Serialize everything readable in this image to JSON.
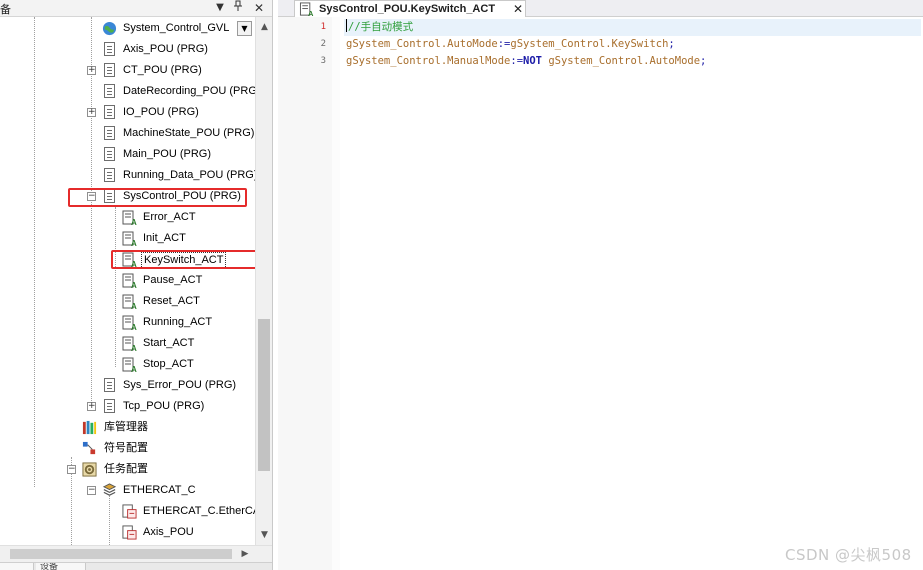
{
  "left_panel": {
    "title": "备",
    "header_buttons": {
      "dropdown": "▼",
      "pin": "ᵖ",
      "close": "✕"
    },
    "tree": {
      "global_var_list": "System_Control_GVL",
      "items": [
        {
          "label": "Axis_POU (PRG)",
          "expander": ""
        },
        {
          "label": "CT_POU (PRG)",
          "expander": "+"
        },
        {
          "label": "DateRecording_POU (PRG)",
          "expander": ""
        },
        {
          "label": "IO_POU (PRG)",
          "expander": "+"
        },
        {
          "label": "MachineState_POU (PRG)",
          "expander": ""
        },
        {
          "label": "Main_POU (PRG)",
          "expander": ""
        },
        {
          "label": "Running_Data_POU (PRG)",
          "expander": ""
        },
        {
          "label": "SysControl_POU (PRG)",
          "expander": "−"
        }
      ],
      "actions": [
        {
          "label": "Error_ACT"
        },
        {
          "label": "Init_ACT"
        },
        {
          "label": "KeySwitch_ACT"
        },
        {
          "label": "Pause_ACT"
        },
        {
          "label": "Reset_ACT"
        },
        {
          "label": "Running_ACT"
        },
        {
          "label": "Start_ACT"
        },
        {
          "label": "Stop_ACT"
        }
      ],
      "after_items": [
        {
          "label": "Sys_Error_POU (PRG)",
          "expander": ""
        },
        {
          "label": "Tcp_POU (PRG)",
          "expander": "+"
        }
      ],
      "library_manager": "库管理器",
      "symbol_config": "符号配置",
      "task_config": "任务配置",
      "task_config_expander": "−",
      "ethercat": "ETHERCAT_C",
      "ethercat_expander": "−",
      "ethercat_children": [
        {
          "label": "ETHERCAT_C.EtherCAT"
        },
        {
          "label": "Axis_POU"
        }
      ]
    },
    "scrollbar": {
      "up": "▲",
      "down": "▼",
      "left": "◀",
      "right": "▶"
    },
    "bottom_tabs": [
      "",
      "设备"
    ]
  },
  "editor": {
    "tab_title": "SysControl_POU.KeySwitch_ACT",
    "tab_close": "✕",
    "current_line": 1,
    "lines": [
      {
        "no": "1",
        "comment": "//手自动模式"
      },
      {
        "no": "2",
        "lhs": "gSystem_Control.AutoMode",
        "op": ":=",
        "rhs": "gSystem_Control.KeySwitch",
        "end": ";"
      },
      {
        "no": "3",
        "lhs": "gSystem_Control.ManualMode",
        "op": ":=",
        "kw": "NOT",
        "rhs": " gSystem_Control.AutoMode",
        "end": ";"
      }
    ]
  },
  "watermark": "CSDN @尖枫508",
  "colors": {
    "highlight_box": "#e52b2b",
    "comment": "#2e9e3b",
    "identifier": "#a86e2c",
    "keyword": "#1b1ba8",
    "current_line_bg": "#e8f2fb"
  }
}
